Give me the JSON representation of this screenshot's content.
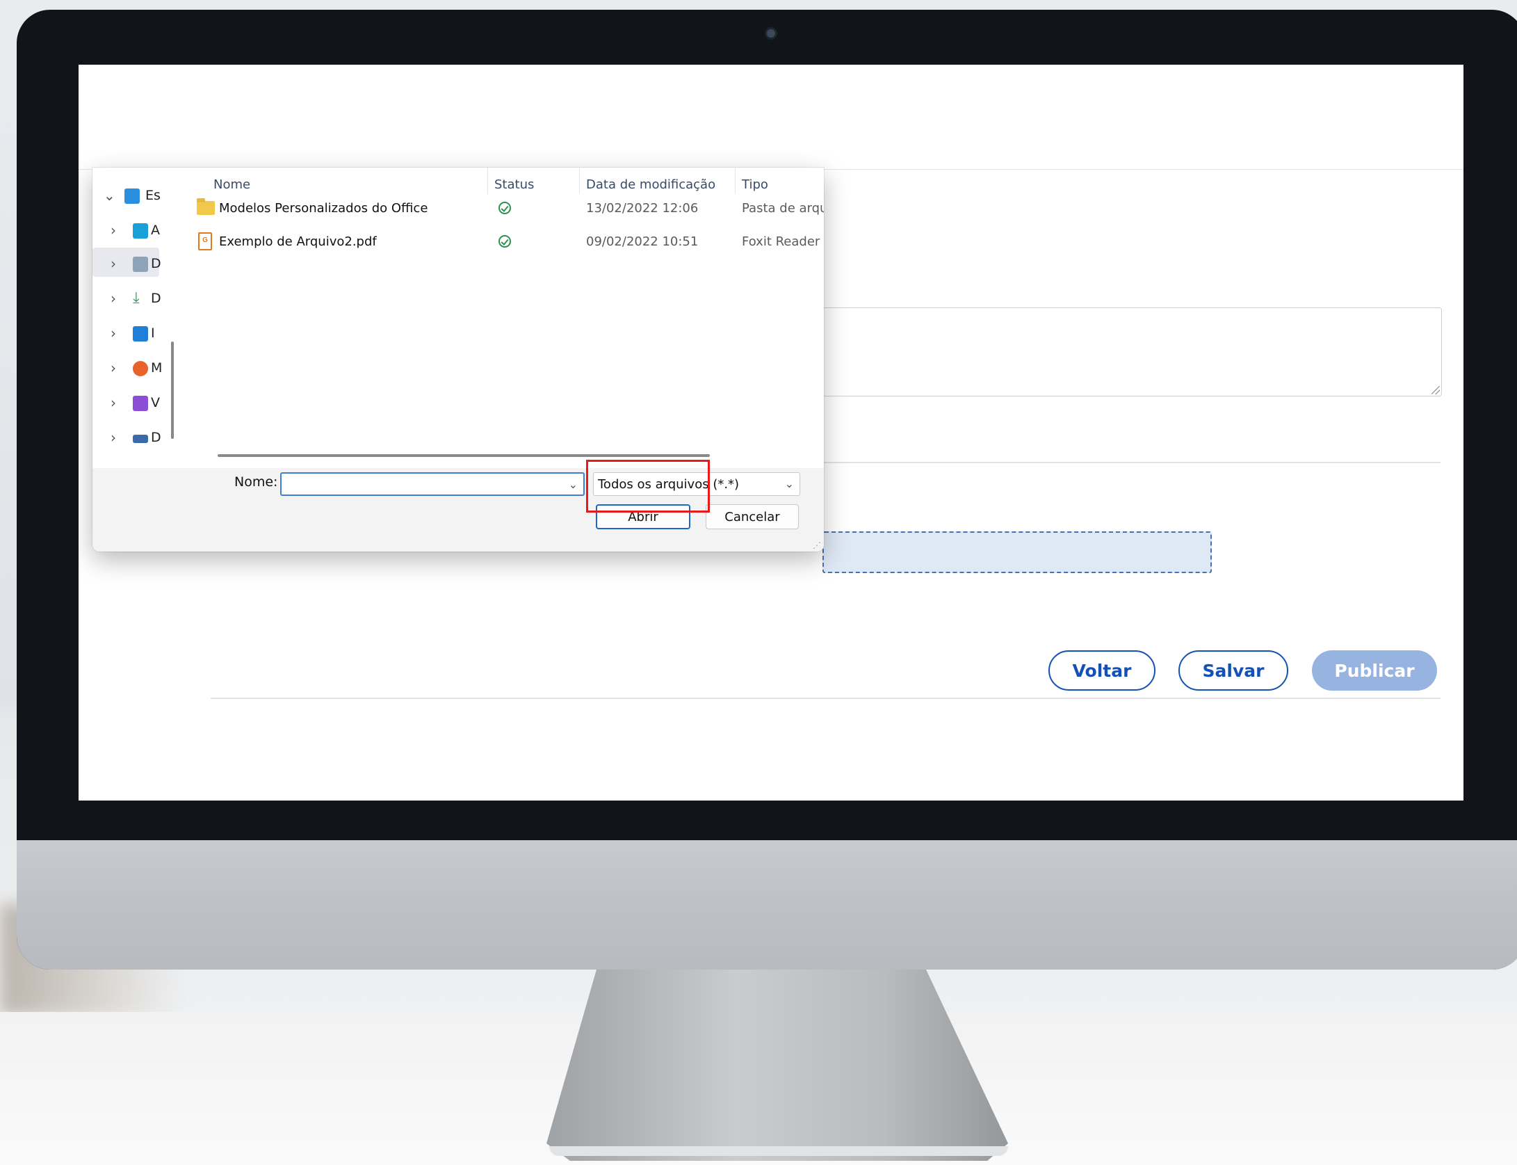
{
  "dialog": {
    "nav": [
      {
        "label": "Es",
        "expanded": true,
        "icon": "desktop-icon"
      },
      {
        "label": "A",
        "icon": "folder-icon"
      },
      {
        "label": "D",
        "icon": "documents-icon"
      },
      {
        "label": "D",
        "icon": "download-icon"
      },
      {
        "label": "I",
        "icon": "pictures-icon"
      },
      {
        "label": "M",
        "icon": "music-icon"
      },
      {
        "label": "V",
        "icon": "videos-icon"
      },
      {
        "label": "D",
        "icon": "drive-icon"
      }
    ],
    "columns": {
      "name": "Nome",
      "status": "Status",
      "modified": "Data de modificação",
      "type": "Tipo"
    },
    "files": [
      {
        "name": "Modelos Personalizados do Office",
        "date": "13/02/2022 12:06",
        "type": "Pasta de arquiv",
        "icon": "folder-icon"
      },
      {
        "name": "Exemplo de Arquivo2.pdf",
        "date": "09/02/2022 10:51",
        "type": "Foxit Reader PD",
        "icon": "pdf-icon"
      }
    ],
    "filename_label": "Nome:",
    "filename_value": "",
    "filetype_value": "Todos os arquivos (*.*)",
    "open_label": "Abrir",
    "cancel_label": "Cancelar"
  },
  "page": {
    "back_label": "Voltar",
    "save_label": "Salvar",
    "publish_label": "Publicar"
  },
  "colors": {
    "primary": "#1351b4",
    "publish_disabled": "#97b3e0",
    "highlight": "#e51b1b"
  }
}
